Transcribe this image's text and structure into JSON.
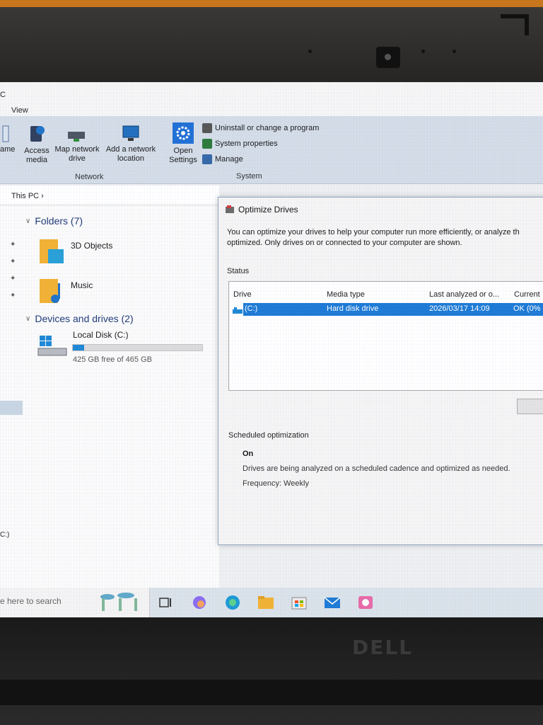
{
  "ribbon": {
    "window_title_fragment": "C",
    "tab_view": "View",
    "network_group": {
      "label": "Network",
      "access_media": "Access media",
      "map_network_drive": "Map network drive",
      "add_network_location": "Add a network location"
    },
    "system_group": {
      "label": "System",
      "open_settings": "Open Settings",
      "uninstall": "Uninstall or change a program",
      "system_properties": "System properties",
      "manage": "Manage"
    },
    "left_fragment": "ame"
  },
  "explorer": {
    "breadcrumb": "This PC",
    "folders_header": "Folders (7)",
    "folder_3d": "3D Objects",
    "folder_music": "Music",
    "devices_header": "Devices and drives (2)",
    "disk_name": "Local Disk (C:)",
    "disk_free": "425 GB free of 465 GB",
    "disk_used_fraction": 0.086,
    "bottom_fragment": "C:)"
  },
  "dialog": {
    "title": "Optimize Drives",
    "description": "You can optimize your drives to help your computer run more efficiently, or analyze th optimized. Only drives on or connected to your computer are shown.",
    "status_label": "Status",
    "columns": [
      "Drive",
      "Media type",
      "Last analyzed or o...",
      "Current"
    ],
    "rows": [
      {
        "drive": "(C:)",
        "media_type": "Hard disk drive",
        "last_analyzed": "2026/03/17 14:09",
        "current": "OK (0%"
      }
    ],
    "scheduled_header": "Scheduled optimization",
    "scheduled_state": "On",
    "scheduled_desc": "Drives are being analyzed on a scheduled cadence and optimized as needed.",
    "frequency": "Frequency: Weekly"
  },
  "taskbar": {
    "search_placeholder": "e here to search"
  },
  "hardware": {
    "brand": "DELL"
  },
  "colors": {
    "accent": "#1c7ad6",
    "ribbon_bg": "#d4dde8",
    "section_header": "#1e3a78"
  }
}
